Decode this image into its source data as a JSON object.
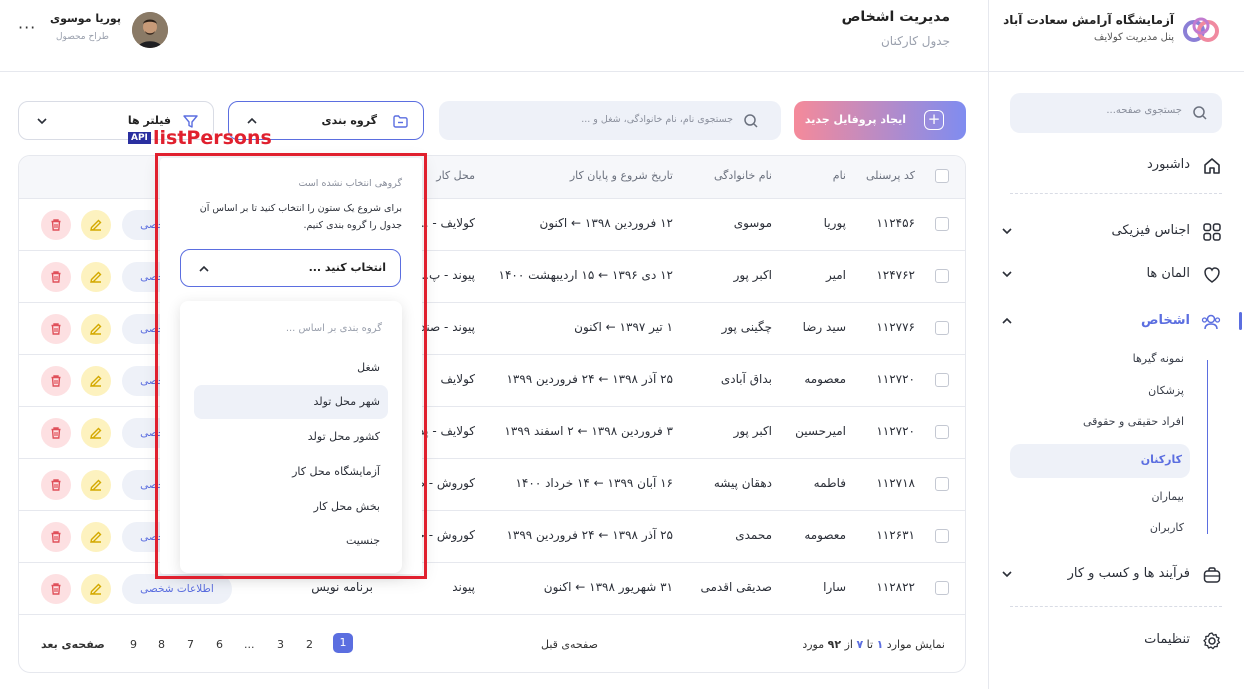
{
  "brand": {
    "name": "آزمایشگاه آرامش سعادت آباد",
    "subtitle": "پنل مدیریت کولایف"
  },
  "sidebar": {
    "search_placeholder": "جستجوی صفحه...",
    "items": [
      {
        "label": "داشبورد",
        "icon": "home-icon"
      },
      {
        "label": "اجناس فیزیکی",
        "icon": "grid-icon"
      },
      {
        "label": "المان ها",
        "icon": "shield-icon"
      },
      {
        "label": "اشخاص",
        "icon": "users-icon"
      },
      {
        "label": "فرآیند ها و کسب و کار",
        "icon": "briefcase-icon"
      },
      {
        "label": "تنظیمات",
        "icon": "gear-icon"
      }
    ],
    "sub_items": [
      "نمونه گیرها",
      "پزشکان",
      "افراد حقیقی و حقوقی",
      "کارکنان",
      "بیماران",
      "کاربران"
    ]
  },
  "header": {
    "title": "مدیریت اشخاص",
    "subtitle": "جدول کارکنان",
    "user_name": "پوریا موسوی",
    "user_role": "طراح محصول",
    "more": "···"
  },
  "toolbar": {
    "new_profile": "ایجاد پروفایل جدید",
    "search_placeholder": "جستجوی نام، نام خانوادگی، شغل و ...",
    "group_by": "گروه بندی",
    "filters": "فیلتر ها"
  },
  "api": {
    "badge": "API",
    "name": "listPersons"
  },
  "table": {
    "columns": [
      "کد پرسنلی",
      "نام",
      "نام خانوادگی",
      "تاریخ شروع و پایان کار",
      "محل کار"
    ],
    "rows": [
      {
        "code": "۱۱۲۴۵۶",
        "name": "پوریا",
        "family": "موسوی",
        "dates": "۱۲ فروردین ۱۳۹۸  ←  اکنون",
        "workplace": "کولایف - ...",
        "tag": "اطلاعات شخصی"
      },
      {
        "code": "۱۲۴۷۶۲",
        "name": "امیر",
        "family": "اکبر پور",
        "dates": "۱۲ دی ۱۳۹۶  ←  ۱۵ اردیبهشت ۱۴۰۰",
        "workplace": "پیوند - پ...",
        "tag": "اطلاعات شخصی"
      },
      {
        "code": "۱۱۲۷۷۶",
        "name": "سید رضا",
        "family": "چگینی پور",
        "dates": "۱ تیر ۱۳۹۷  ←  اکنون",
        "workplace": "پیوند - صندو...",
        "tag": "اطلاعات شخصی"
      },
      {
        "code": "۱۱۲۷۲۰",
        "name": "معصومه",
        "family": "بداق آبادی",
        "dates": "۲۵ آذر ۱۳۹۸  ←  ۲۴ فروردین ۱۳۹۹",
        "workplace": "کولایف",
        "tag": "اطلاعات شخصی"
      },
      {
        "code": "۱۱۲۷۲۰",
        "name": "امیرحسین",
        "family": "اکبر پور",
        "dates": "۳ فروردین ۱۳۹۸  ←  ۲ اسفند ۱۳۹۹",
        "workplace": "کولایف - پذیر...",
        "tag": "اطلاعات شخصی"
      },
      {
        "code": "۱۱۲۷۱۸",
        "name": "فاطمه",
        "family": "دهقان پیشه",
        "dates": "۱۶ آبان ۱۳۹۹  ←  ۱۴ خرداد ۱۴۰۰",
        "workplace": "کوروش - صن...",
        "tag": "اطلاعات شخصی"
      },
      {
        "code": "۱۱۲۶۳۱",
        "name": "معصومه",
        "family": "محمدی",
        "dates": "۲۵ آذر ۱۳۹۸  ←  ۲۴ فروردین ۱۳۹۹",
        "workplace": "کوروش - جوا...",
        "tag": "اطلاعات شخصی"
      },
      {
        "code": "۱۱۲۸۲۲",
        "name": "سارا",
        "family": "صدیقی اقدمی",
        "dates": "۳۱ شهریور ۱۳۹۸  ←  اکنون",
        "workplace": "پیوند",
        "job": "برنامه نویس",
        "tag": "اطلاعات شخصی"
      }
    ]
  },
  "pagination": {
    "summary_prefix": "نمایش موارد",
    "from": "۱",
    "to_word": "تا",
    "to": "۷",
    "of_word": "از",
    "total": "۹۲",
    "unit": "مورد",
    "prev": "صفحه‌ی قبل",
    "next": "صفحه‌ی بعد",
    "pages": [
      "1",
      "2",
      "3",
      "...",
      "6",
      "7",
      "8",
      "9"
    ],
    "current": "1"
  },
  "group_dropdown": {
    "empty_text": "گروهی انتخاب نشده است",
    "help_text": "برای شروع یک ستون را انتخاب کنید تا بر اساس آن جدول را گروه بندی کنیم.",
    "select_placeholder": "انتخاب کنید ...",
    "list_header": "گروه بندی بر اساس ...",
    "options": [
      "شغل",
      "شهر محل تولد",
      "کشور محل تولد",
      "آزمایشگاه محل کار",
      "بخش محل کار",
      "جنسیت"
    ],
    "highlighted": "شهر محل تولد"
  },
  "colors": {
    "accent": "#5b6ee0",
    "danger": "#e0202e",
    "edit_bg": "#fdf2bf",
    "delete_bg": "#fde0e2"
  }
}
